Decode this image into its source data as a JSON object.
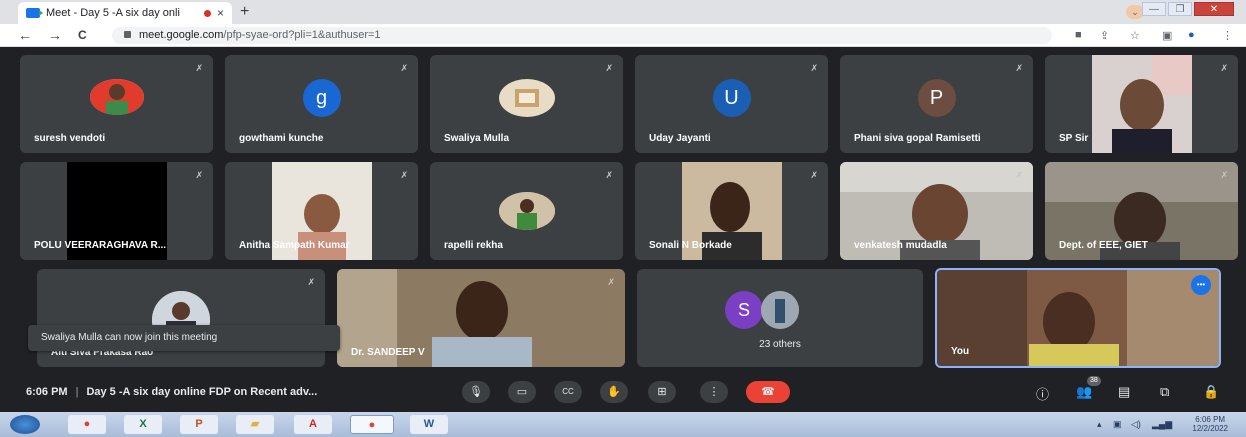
{
  "browser": {
    "tab_title": "Meet - Day 5 -A six day onli",
    "tab_close": "×",
    "new_tab": "+",
    "collapse": "⌄",
    "win_minimize": "—",
    "win_maximize": "❐",
    "win_close": "✕",
    "back": "←",
    "forward": "→",
    "reload": "C",
    "url_host": "meet.google.com",
    "url_path": "/pfp-syae-ord?pli=1&authuser=1"
  },
  "meeting": {
    "participants": [
      {
        "name": "suresh vendoti",
        "kind": "photo",
        "color": "#d0443a"
      },
      {
        "name": "gowthami kunche",
        "kind": "letter",
        "letter": "g",
        "color": "#1967d2"
      },
      {
        "name": "Swaliya Mulla",
        "kind": "photo",
        "color": "#c9b79a"
      },
      {
        "name": "Uday Jayanti",
        "kind": "letter",
        "letter": "U",
        "color": "#1a5fb4"
      },
      {
        "name": "Phani siva gopal Ramisetti",
        "kind": "letter",
        "letter": "P",
        "color": "#6d4c41"
      },
      {
        "name": "SP Sir",
        "kind": "video"
      },
      {
        "name": "POLU VEERARAGHAVA R...",
        "kind": "video"
      },
      {
        "name": "Anitha Sampath Kumar",
        "kind": "video"
      },
      {
        "name": "rapelli rekha",
        "kind": "photo",
        "color": "#b58a57"
      },
      {
        "name": "Sonali N Borkade",
        "kind": "video"
      },
      {
        "name": "venkatesh mudadla",
        "kind": "video"
      },
      {
        "name": "Dept. of EEE, GIET",
        "kind": "video"
      },
      {
        "name": "Alti Siva Prakasa Rao",
        "kind": "photo"
      },
      {
        "name": "Dr. SANDEEP V",
        "kind": "video"
      },
      {
        "name": "23 others",
        "kind": "others",
        "letter": "S",
        "color": "#7b3fc4"
      },
      {
        "name": "You",
        "kind": "video"
      }
    ],
    "toast": "Swaliya Mulla can now join this meeting",
    "time": "6:06 PM",
    "separator": "|",
    "title": "Day 5 -A six day online FDP on Recent adv...",
    "participant_count": "38",
    "more_icon": "•••"
  },
  "taskbar": {
    "clock_time": "6:06 PM",
    "clock_date": "12/2/2022"
  },
  "colors": {
    "meet_bg": "#202124",
    "tile_bg": "#3c4043",
    "end_call": "#ea4335",
    "active_speaker_border": "#8ab4f8"
  }
}
